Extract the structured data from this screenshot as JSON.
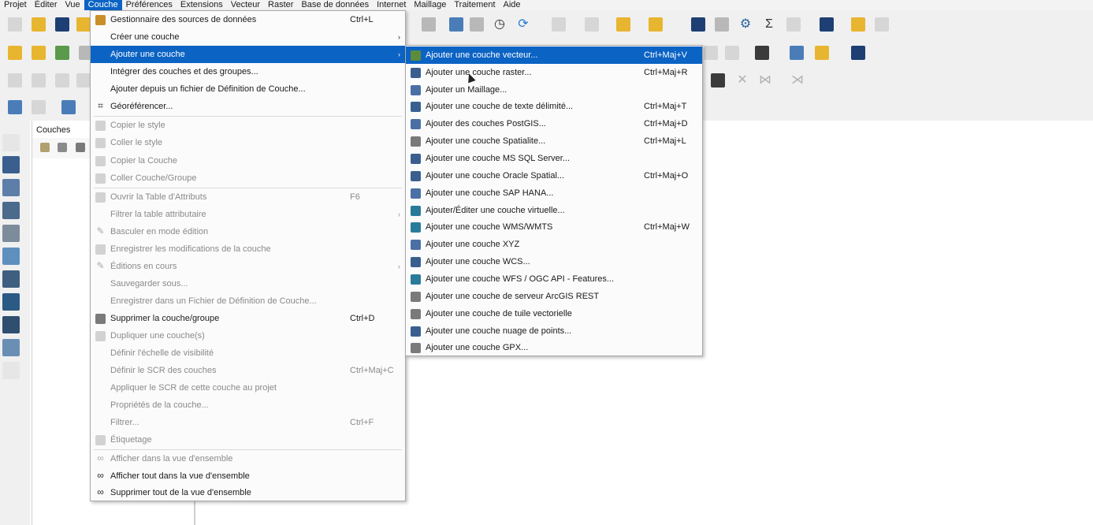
{
  "menubar": {
    "items": [
      "Projet",
      "Éditer",
      "Vue",
      "Couche",
      "Préférences",
      "Extensions",
      "Vecteur",
      "Raster",
      "Base de données",
      "Internet",
      "Maillage",
      "Traitement",
      "Aide"
    ],
    "active_index": 3
  },
  "layers_panel": {
    "title": "Couches"
  },
  "couche_menu": {
    "items": [
      {
        "label": "Gestionnaire des sources de données",
        "shortcut": "Ctrl+L",
        "icon": "datasource-manager-icon",
        "disabled": false
      },
      {
        "label": "Créer une couche",
        "submenu": true,
        "disabled": false
      },
      {
        "label": "Ajouter une couche",
        "submenu": true,
        "highlighted": true,
        "disabled": false
      },
      {
        "label": "Intégrer des couches et des groupes...",
        "disabled": false
      },
      {
        "label": "Ajouter depuis un fichier de Définition de Couche...",
        "disabled": false
      },
      {
        "label": "Géoréférencer...",
        "icon": "georeferencer-icon",
        "disabled": false
      },
      {
        "label": "Copier le style",
        "icon": "copy-style-icon",
        "disabled": true
      },
      {
        "label": "Coller le style",
        "icon": "paste-style-icon",
        "disabled": true
      },
      {
        "label": "Copier la Couche",
        "icon": "copy-layer-icon",
        "disabled": true
      },
      {
        "label": "Coller Couche/Groupe",
        "icon": "paste-layer-icon",
        "disabled": true
      },
      {
        "label": "Ouvrir la Table d'Attributs",
        "shortcut": "F6",
        "icon": "attribute-table-icon",
        "disabled": true
      },
      {
        "label": "Filtrer la table attributaire",
        "submenu": true,
        "disabled": true
      },
      {
        "label": "Basculer en mode édition",
        "icon": "edit-pencil-icon",
        "disabled": true
      },
      {
        "label": "Enregistrer les modifications de la couche",
        "icon": "save-edits-icon",
        "disabled": true
      },
      {
        "label": "Éditions en cours",
        "submenu": true,
        "icon": "current-edits-icon",
        "disabled": true
      },
      {
        "label": "Sauvegarder sous...",
        "disabled": true
      },
      {
        "label": "Enregistrer dans un Fichier de Définition de Couche...",
        "disabled": true
      },
      {
        "label": "Supprimer la couche/groupe",
        "shortcut": "Ctrl+D",
        "icon": "remove-layer-icon",
        "disabled": false
      },
      {
        "label": "Dupliquer une couche(s)",
        "icon": "duplicate-layer-icon",
        "disabled": true
      },
      {
        "label": "Définir l'échelle de visibilité",
        "disabled": true
      },
      {
        "label": "Définir le SCR des couches",
        "shortcut": "Ctrl+Maj+C",
        "disabled": true
      },
      {
        "label": "Appliquer le SCR de cette couche au projet",
        "disabled": true
      },
      {
        "label": "Propriétés de la couche...",
        "disabled": true
      },
      {
        "label": "Filtrer...",
        "shortcut": "Ctrl+F",
        "disabled": true
      },
      {
        "label": "Étiquetage",
        "icon": "labeling-icon",
        "disabled": true
      },
      {
        "label": "Afficher dans la vue d'ensemble",
        "icon": "overview-glasses-icon",
        "disabled": true
      },
      {
        "label": "Afficher tout dans la vue d'ensemble",
        "icon": "overview-all-glasses-icon",
        "disabled": false
      },
      {
        "label": "Supprimer tout de la vue d'ensemble",
        "icon": "overview-remove-glasses-icon",
        "disabled": false
      }
    ]
  },
  "add_layer_submenu": {
    "items": [
      {
        "label": "Ajouter une couche vecteur...",
        "shortcut": "Ctrl+Maj+V",
        "icon": "vector-layer-icon",
        "highlighted": true
      },
      {
        "label": "Ajouter une couche raster...",
        "shortcut": "Ctrl+Maj+R",
        "icon": "raster-layer-icon"
      },
      {
        "label": "Ajouter un Maillage...",
        "icon": "mesh-layer-icon"
      },
      {
        "label": "Ajouter une couche de texte délimité...",
        "shortcut": "Ctrl+Maj+T",
        "icon": "delimited-text-icon"
      },
      {
        "label": "Ajouter des couches PostGIS...",
        "shortcut": "Ctrl+Maj+D",
        "icon": "postgis-icon"
      },
      {
        "label": "Ajouter une couche Spatialite...",
        "shortcut": "Ctrl+Maj+L",
        "icon": "spatialite-icon"
      },
      {
        "label": "Ajouter une couche MS SQL Server...",
        "icon": "mssql-icon"
      },
      {
        "label": "Ajouter une couche Oracle Spatial...",
        "shortcut": "Ctrl+Maj+O",
        "icon": "oracle-icon"
      },
      {
        "label": "Ajouter une couche SAP HANA...",
        "icon": "sap-hana-icon"
      },
      {
        "label": "Ajouter/Éditer une couche virtuelle...",
        "icon": "virtual-layer-icon"
      },
      {
        "label": "Ajouter une couche WMS/WMTS",
        "shortcut": "Ctrl+Maj+W",
        "icon": "wms-icon"
      },
      {
        "label": "Ajouter une couche XYZ",
        "icon": "xyz-icon"
      },
      {
        "label": "Ajouter une couche WCS...",
        "icon": "wcs-icon"
      },
      {
        "label": "Ajouter une couche WFS / OGC API - Features...",
        "icon": "wfs-icon"
      },
      {
        "label": "Ajouter une couche de serveur ArcGIS REST",
        "icon": "arcgis-rest-icon"
      },
      {
        "label": "Ajouter une couche de tuile vectorielle",
        "icon": "vector-tile-icon"
      },
      {
        "label": "Ajouter une couche nuage de points...",
        "icon": "point-cloud-icon"
      },
      {
        "label": "Ajouter une couche GPX...",
        "icon": "gpx-icon"
      }
    ]
  }
}
